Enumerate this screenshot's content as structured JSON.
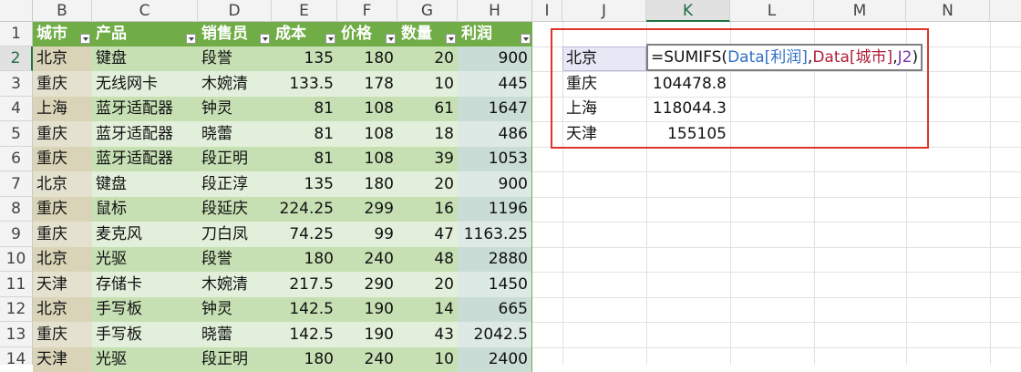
{
  "columns": [
    "B",
    "C",
    "D",
    "E",
    "F",
    "G",
    "H",
    "I",
    "J",
    "K",
    "L",
    "M",
    "N"
  ],
  "selected_column": "K",
  "selected_row": "2",
  "rows": [
    "1",
    "2",
    "3",
    "4",
    "5",
    "6",
    "7",
    "8",
    "9",
    "10",
    "11",
    "12",
    "13",
    "14"
  ],
  "table": {
    "headers": [
      "城市",
      "产品",
      "销售员",
      "成本",
      "价格",
      "数量",
      "利润"
    ],
    "data": [
      [
        "北京",
        "键盘",
        "段誉",
        "135",
        "180",
        "20",
        "900"
      ],
      [
        "重庆",
        "无线网卡",
        "木婉清",
        "133.5",
        "178",
        "10",
        "445"
      ],
      [
        "上海",
        "蓝牙适配器",
        "钟灵",
        "81",
        "108",
        "61",
        "1647"
      ],
      [
        "重庆",
        "蓝牙适配器",
        "晓蕾",
        "81",
        "108",
        "18",
        "486"
      ],
      [
        "重庆",
        "蓝牙适配器",
        "段正明",
        "81",
        "108",
        "39",
        "1053"
      ],
      [
        "北京",
        "键盘",
        "段正淳",
        "135",
        "180",
        "20",
        "900"
      ],
      [
        "重庆",
        "鼠标",
        "段延庆",
        "224.25",
        "299",
        "16",
        "1196"
      ],
      [
        "重庆",
        "麦克风",
        "刀白凤",
        "74.25",
        "99",
        "47",
        "1163.25"
      ],
      [
        "北京",
        "光驱",
        "段誉",
        "180",
        "240",
        "48",
        "2880"
      ],
      [
        "天津",
        "存储卡",
        "木婉清",
        "217.5",
        "290",
        "20",
        "1450"
      ],
      [
        "北京",
        "手写板",
        "钟灵",
        "142.5",
        "190",
        "14",
        "665"
      ],
      [
        "重庆",
        "手写板",
        "晓蕾",
        "142.5",
        "190",
        "43",
        "2042.5"
      ],
      [
        "天津",
        "光驱",
        "段正明",
        "180",
        "240",
        "10",
        "2400"
      ]
    ]
  },
  "summary": {
    "cities": [
      "北京",
      "重庆",
      "上海",
      "天津"
    ],
    "values": [
      "",
      "104478.8",
      "118044.3",
      "155105"
    ]
  },
  "formula": {
    "eq": "=SUMIFS(",
    "arg1": "Data[利润]",
    "sep1": ",",
    "arg2": "Data[城市]",
    "sep2": ",",
    "arg3": "J2",
    "close": ")"
  },
  "colors": {
    "header_green": "#70ad47",
    "band_dark": "#c6e0b4",
    "band_light": "#e2efda",
    "highlight_border": "#e0342a"
  }
}
